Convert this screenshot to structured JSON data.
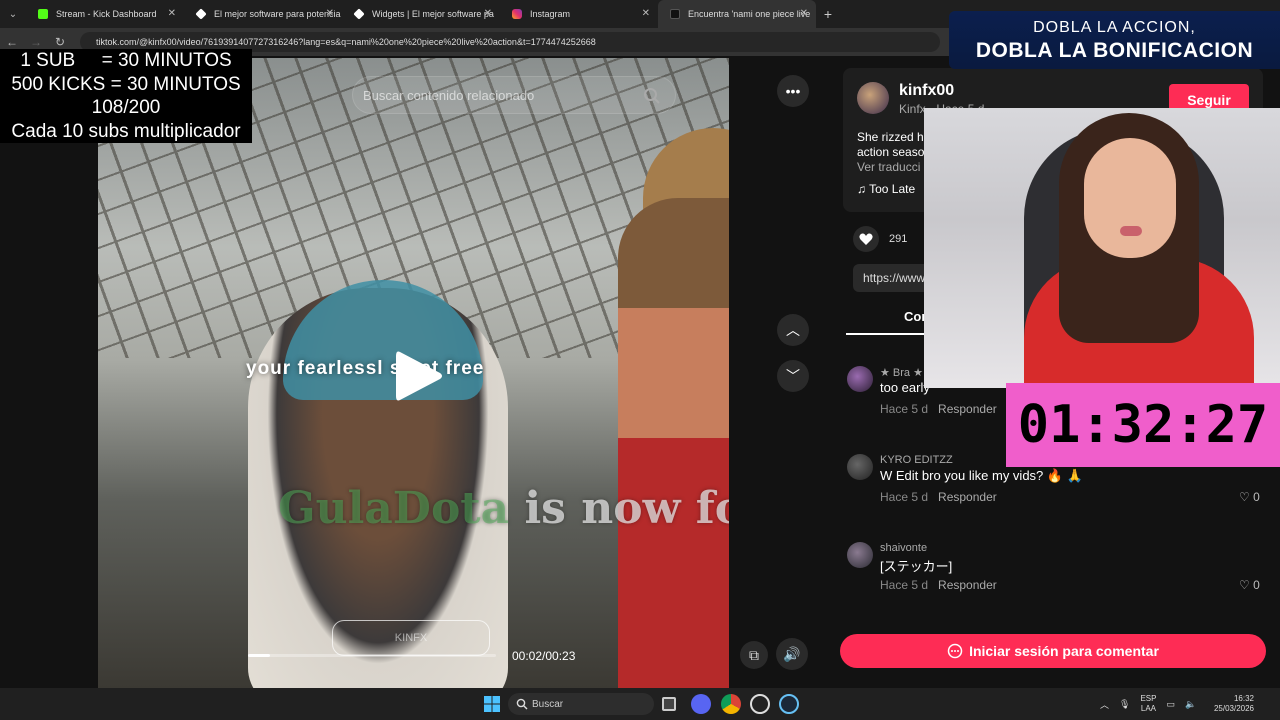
{
  "browser": {
    "tabs": [
      {
        "title": "Stream - Kick Dashboard",
        "fav_color": "#53fc18"
      },
      {
        "title": "El mejor software para potencia",
        "fav_color": "#ffffff"
      },
      {
        "title": "Widgets | El mejor software pa",
        "fav_color": "#ffffff"
      },
      {
        "title": "Instagram",
        "fav_color": "#e1306c"
      },
      {
        "title": "Encuentra 'nami one piece live",
        "fav_color": "#111111"
      }
    ],
    "tab_close": "✕",
    "new_tab": "+",
    "url": "tiktok.com/@kinfx00/video/7619391407727316246?lang=es&q=nami%20one%20piece%20live%20action&t=1774474252668"
  },
  "stream_overlay": {
    "lines": [
      "1 SUB     = 30 MINUTOS",
      "500 KICKS = 30 MINUTOS",
      "108/200",
      "Cada 10 subs multiplicador"
    ],
    "banner_line1": "DOBLA LA ACCION,",
    "banner_line2": "DOBLA LA BONIFICACION",
    "timer": "01:32:27"
  },
  "video": {
    "search_placeholder": "Buscar contenido relacionado",
    "caption": "your fearlessl     s get free",
    "follow_user": "GulaDota",
    "follow_text": " is now following!",
    "watermark": "KINFX",
    "progress_fraction": 0.09,
    "time": "00:02/00:23"
  },
  "panel": {
    "username": "kinfx00",
    "subline": "Kinfx · Hace 5 d",
    "follow_label": "Seguir",
    "description": "She rizzed h\naction seaso",
    "translate": "Ver traducci",
    "music": "♫  Too Late",
    "likes": "291",
    "link": "https://www",
    "tab_comments": "Comentarios",
    "comments": [
      {
        "user": "★ Bra ★",
        "text": "too early",
        "time": "Hace 5 d",
        "reply": "Responder",
        "likes": ""
      },
      {
        "user": "KYRO EDITZZ",
        "text": "W Edit bro you like my vids? 🔥 🙏",
        "time": "Hace 5 d",
        "reply": "Responder",
        "likes": "♡ 0"
      },
      {
        "user": "shaivonte",
        "text": "[ステッカー]",
        "time": "Hace 5 d",
        "reply": "Responder",
        "likes": "♡ 0"
      }
    ],
    "comment_login": "Iniciar sesión para comentar"
  },
  "taskbar": {
    "search_placeholder": "Buscar",
    "lang_line1": "ESP",
    "lang_line2": "LAA",
    "time": "16:32",
    "date": "25/03/2026"
  }
}
